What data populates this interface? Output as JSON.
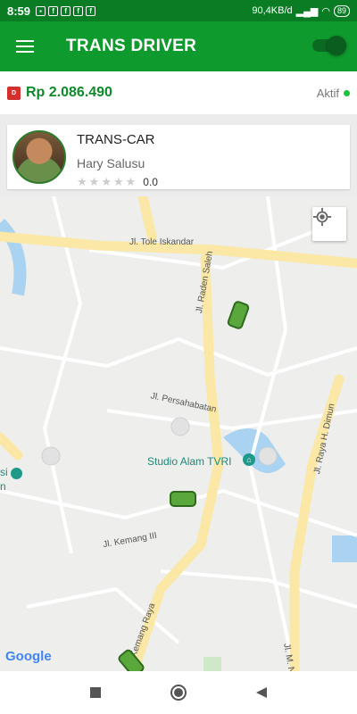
{
  "status_bar": {
    "time": "8:59",
    "network_speed": "90,4KB/d",
    "battery": "89"
  },
  "app_bar": {
    "title": "TRANS DRIVER",
    "online_toggle_on": true
  },
  "balance_bar": {
    "balance": "Rp 2.086.490",
    "status": "Aktif"
  },
  "driver": {
    "service": "TRANS-CAR",
    "name": "Hary Salusu",
    "rating": "0.0",
    "stars_filled": 0
  },
  "map": {
    "street_labels": [
      "Jl. Tole Iskandar",
      "Jl. Raden Saleh",
      "Jl. Persahabatan",
      "Jl. Kemang III",
      "Jl. Raya H. Dimun",
      "Jl. M. Nasir",
      "Jl. Kemang Raya"
    ],
    "poi_labels": [
      "Studio Alam TVRI",
      "si",
      "n"
    ],
    "attribution": "Google"
  },
  "icons": {
    "menu": "menu-icon",
    "locate": "my-location-icon",
    "back": "back-icon",
    "home": "home-icon",
    "recents": "recents-icon"
  },
  "colors": {
    "primary": "#0e9a2c",
    "status_bar": "#0a7d24",
    "balance": "#0e8a2a",
    "active_dot": "#19c23a"
  }
}
